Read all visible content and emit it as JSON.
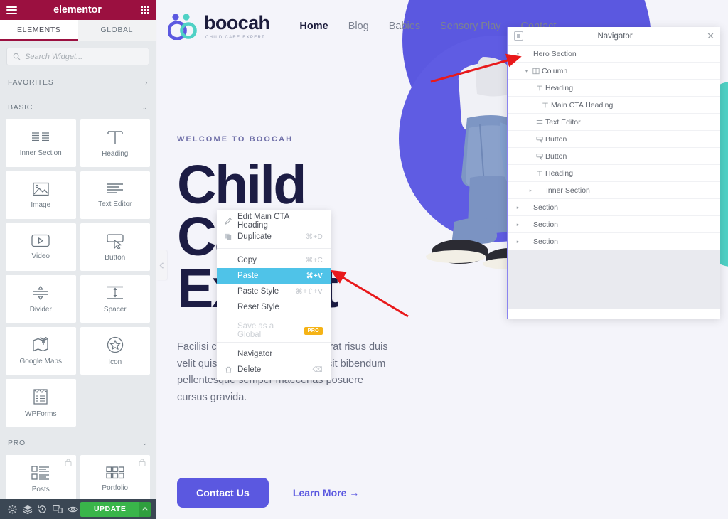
{
  "panel": {
    "brand": "elementor",
    "menu_icon": "hamburger-icon",
    "apps_icon": "grid-icon",
    "tabs": [
      {
        "label": "ELEMENTS",
        "active": true
      },
      {
        "label": "GLOBAL",
        "active": false
      }
    ],
    "search": {
      "placeholder": "Search Widget...",
      "value": "",
      "icon": "search-icon"
    },
    "categories": [
      {
        "label": "FAVORITES",
        "state": "collapsed",
        "chevron": "›"
      },
      {
        "label": "BASIC",
        "state": "expanded",
        "chevron": "⌄"
      },
      {
        "label": "PRO",
        "state": "expanded",
        "chevron": "⌄"
      }
    ],
    "basic_widgets": [
      {
        "label": "Inner Section",
        "icon": "inner-section-icon"
      },
      {
        "label": "Heading",
        "icon": "heading-icon"
      },
      {
        "label": "Image",
        "icon": "image-icon"
      },
      {
        "label": "Text Editor",
        "icon": "text-editor-icon"
      },
      {
        "label": "Video",
        "icon": "video-icon"
      },
      {
        "label": "Button",
        "icon": "button-icon"
      },
      {
        "label": "Divider",
        "icon": "divider-icon"
      },
      {
        "label": "Spacer",
        "icon": "spacer-icon"
      },
      {
        "label": "Google Maps",
        "icon": "google-maps-icon"
      },
      {
        "label": "Icon",
        "icon": "star-icon"
      },
      {
        "label": "WPForms",
        "icon": "wpforms-icon"
      }
    ],
    "pro_widgets": [
      {
        "label": "Posts",
        "icon": "posts-icon",
        "locked": true
      },
      {
        "label": "Portfolio",
        "icon": "portfolio-icon",
        "locked": true
      }
    ],
    "footer": {
      "buttons": [
        {
          "name": "settings",
          "icon": "gear-icon"
        },
        {
          "name": "navigator",
          "icon": "layers-icon"
        },
        {
          "name": "history",
          "icon": "history-icon"
        },
        {
          "name": "responsive",
          "icon": "responsive-icon"
        },
        {
          "name": "preview",
          "icon": "eye-icon"
        }
      ],
      "update_label": "UPDATE",
      "update_caret": "▲",
      "update_color": "#39b54a"
    },
    "collapse_handle_icon": "chevron-left-icon"
  },
  "site": {
    "logo": {
      "name": "boocah",
      "tagline": "CHILD CARE EXPERT",
      "icon": "boocah-logo-icon"
    },
    "nav": [
      {
        "label": "Home",
        "active": true
      },
      {
        "label": "Blog",
        "active": false
      },
      {
        "label": "Babies",
        "active": false
      },
      {
        "label": "Sensory Play",
        "active": false
      },
      {
        "label": "Contact",
        "active": false
      }
    ],
    "hero": {
      "eyebrow": "WELCOME TO BOOCAH",
      "title": "Child\nCare\nExpert",
      "paragraph": "Facilisi commodo ac consequat erat risus duis velit quis velit fermentum feugiat sit bibendum pellentesque semper maecenas posuere cursus gravida.",
      "primary_button": "Contact Us",
      "secondary_link": "Learn More  →",
      "accent_purple": "#5b58e0",
      "accent_teal": "#4fd1c5",
      "title_color": "#1c1c44"
    }
  },
  "context_menu": {
    "items": [
      {
        "label": "Edit Main CTA Heading",
        "shortcut": "",
        "icon": "pencil-icon",
        "state": "normal"
      },
      {
        "label": "Duplicate",
        "shortcut": "⌘+D",
        "icon": "duplicate-icon",
        "state": "normal"
      },
      {
        "separator_after": true
      },
      {
        "label": "Copy",
        "shortcut": "⌘+C",
        "icon": "",
        "state": "normal"
      },
      {
        "label": "Paste",
        "shortcut": "⌘+V",
        "icon": "",
        "state": "highlight"
      },
      {
        "label": "Paste Style",
        "shortcut": "⌘+⇧+V",
        "icon": "",
        "state": "normal"
      },
      {
        "label": "Reset Style",
        "shortcut": "",
        "icon": "",
        "state": "normal"
      },
      {
        "separator_after": true
      },
      {
        "label": "Save as a Global",
        "shortcut": "",
        "icon": "",
        "state": "disabled",
        "badge": "PRO"
      },
      {
        "separator_after": true
      },
      {
        "label": "Navigator",
        "shortcut": "",
        "icon": "",
        "state": "normal"
      },
      {
        "label": "Delete",
        "shortcut": "⌫",
        "icon": "trash-icon",
        "state": "normal"
      }
    ],
    "highlight_color": "#4fc3e8",
    "badge_color": "#f5b316"
  },
  "navigator": {
    "title": "Navigator",
    "dock_icon": "dock-icon",
    "close_icon": "close-icon",
    "footer_icon": "resize-dots",
    "footer_label": "···",
    "tree": [
      {
        "label": "Hero Section",
        "depth": 0,
        "caret": "▾",
        "icon": ""
      },
      {
        "label": "Column",
        "depth": 1,
        "caret": "▾",
        "icon": "column-icon"
      },
      {
        "label": "Heading",
        "depth": 2,
        "caret": "",
        "icon": "heading-icon"
      },
      {
        "label": "Main CTA Heading",
        "depth": 2,
        "caret": "",
        "icon": "heading-icon"
      },
      {
        "label": "Text Editor",
        "depth": 2,
        "caret": "",
        "icon": "text-editor-icon"
      },
      {
        "label": "Button",
        "depth": 2,
        "caret": "",
        "icon": "button-icon"
      },
      {
        "label": "Button",
        "depth": 2,
        "caret": "",
        "icon": "button-icon"
      },
      {
        "label": "Heading",
        "depth": 2,
        "caret": "",
        "icon": "heading-icon"
      },
      {
        "label": "Inner Section",
        "depth": 1,
        "caret": "▸",
        "icon": ""
      },
      {
        "label": "Section",
        "depth": 0,
        "caret": "▸",
        "icon": ""
      },
      {
        "label": "Section",
        "depth": 0,
        "caret": "▸",
        "icon": ""
      },
      {
        "label": "Section",
        "depth": 0,
        "caret": "▸",
        "icon": ""
      }
    ]
  },
  "annotations": {
    "arrow_color": "#e8191b",
    "arrows": [
      {
        "name": "arrow-to-hero-section",
        "points_at": "Hero Section"
      },
      {
        "name": "arrow-to-paste",
        "points_at": "Paste"
      }
    ]
  }
}
